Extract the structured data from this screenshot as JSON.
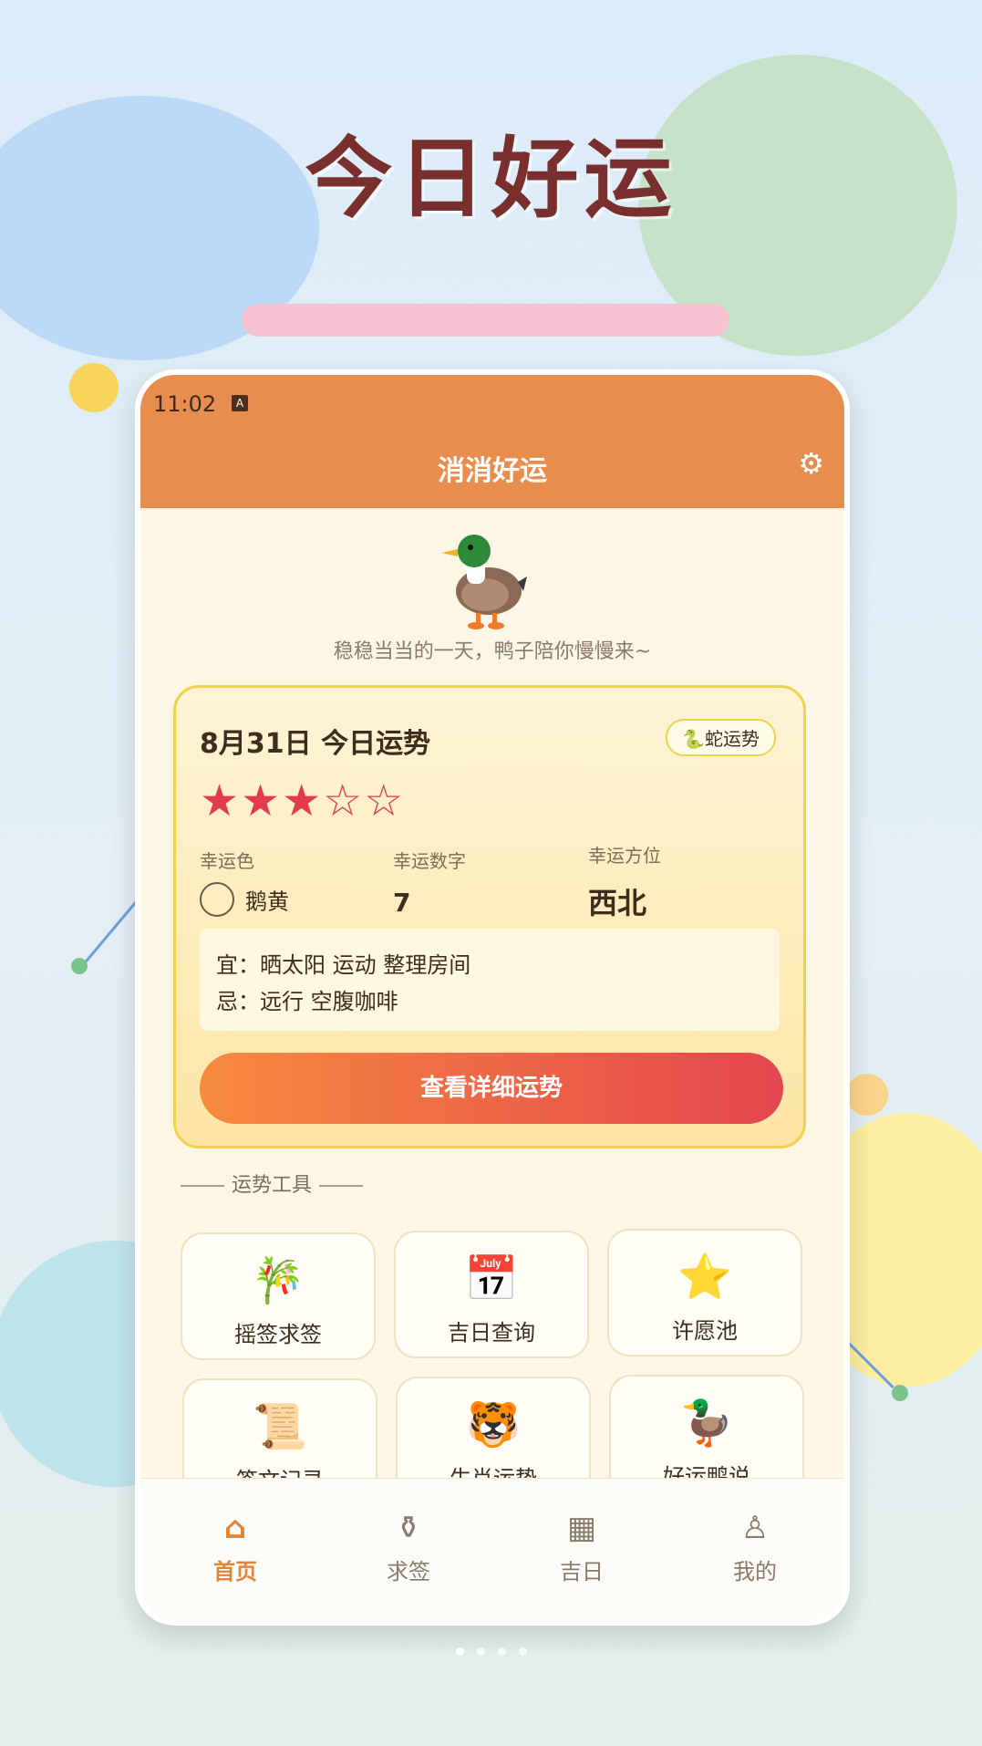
{
  "promo": {
    "title": "今日好运"
  },
  "status_bar": {
    "time": "11:02",
    "indicator": "A"
  },
  "app_bar": {
    "title": "消消好运",
    "settings_icon": "gear-icon"
  },
  "mascot": {
    "icon": "duck-icon",
    "subtitle": "稳稳当当的一天，鸭子陪你慢慢来~"
  },
  "fortune": {
    "title": "8月31日 今日运势",
    "zodiac_badge": "🐍蛇运势",
    "rating": 3,
    "rating_max": 5,
    "stars_filled": "★★★",
    "stars_empty": "☆☆",
    "lucky_color": {
      "label": "幸运色",
      "value": "鹅黄"
    },
    "lucky_number": {
      "label": "幸运数字",
      "value": "7"
    },
    "lucky_direction": {
      "label": "幸运方位",
      "value": "西北"
    },
    "do": "宜：晒太阳 运动 整理房间",
    "dont": "忌：远行 空腹咖啡",
    "detail_button": "查看详细运势"
  },
  "tools_section": {
    "title": "运势工具"
  },
  "tools": [
    {
      "label": "摇签求签",
      "icon": "bamboo-icon",
      "glyph": "🎋"
    },
    {
      "label": "吉日查询",
      "icon": "calendar-icon",
      "glyph": "📅"
    },
    {
      "label": "许愿池",
      "icon": "star-icon",
      "glyph": "⭐"
    },
    {
      "label": "签文记录",
      "icon": "scroll-icon",
      "glyph": "📜"
    },
    {
      "label": "生肖运势",
      "icon": "tiger-icon",
      "glyph": "🐯"
    },
    {
      "label": "好运鸭说",
      "icon": "duck-icon",
      "glyph": "🦆"
    }
  ],
  "bottom_nav": [
    {
      "label": "首页",
      "icon": "home-icon",
      "glyph": "⌂",
      "active": true
    },
    {
      "label": "求签",
      "icon": "fortune-stick-icon",
      "glyph": "⚱",
      "active": false
    },
    {
      "label": "吉日",
      "icon": "calendar-icon",
      "glyph": "▦",
      "active": false
    },
    {
      "label": "我的",
      "icon": "profile-icon",
      "glyph": "♙",
      "active": false
    }
  ],
  "colors": {
    "accent": "#e78d4d",
    "star": "#e23b4e",
    "card_border": "#f1d24a"
  }
}
